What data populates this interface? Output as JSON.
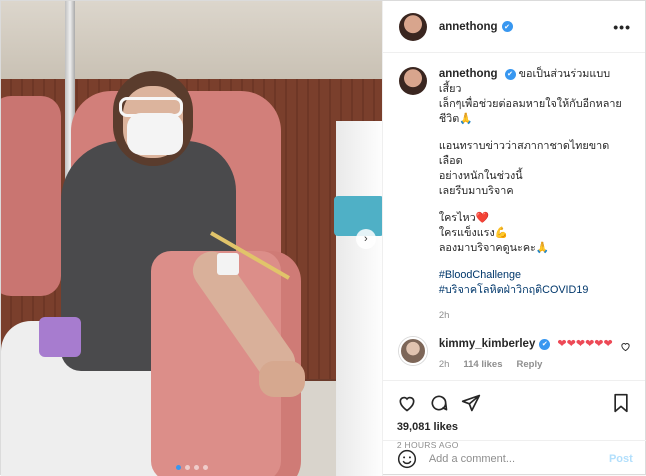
{
  "post": {
    "author": "annethong",
    "verified_mark": "✔",
    "more_icon": "more-dots-icon",
    "media": {
      "dots_count": 4,
      "active_dot": 0,
      "next_icon": "chevron-right-icon",
      "next_glyph": "›"
    },
    "caption": {
      "username": "annethong",
      "lines": [
        "ขอเป็นส่วนร่วมแบบเสี้ยว",
        "เล็กๆเพื่อช่วยต่อลมหายใจให้กับอีกหลาย",
        "ชีวิต🙏"
      ],
      "paragraph2": [
        "แอนทราบข่าวว่าสภากาชาดไทยขาดเลือด",
        "อย่างหนักในช่วงนี้",
        "เลยรีบมาบริจาค"
      ],
      "paragraph3": [
        "ใครไหว❤️",
        "ใครแข็งแรง💪",
        "ลองมาบริจาคดูนะคะ🙏"
      ],
      "hashtags": [
        "#BloodChallenge",
        "#บริจาคโลหิตฝ่าวิกฤติCOVID19"
      ],
      "time": "2h"
    },
    "comments": [
      {
        "username": "kimmy_kimberley",
        "text": "❤❤❤❤❤❤",
        "time": "2h",
        "likes": "114 likes",
        "reply_label": "Reply"
      }
    ],
    "likes": "39,081 likes",
    "timestamp": "2 HOURS AGO",
    "add_comment": {
      "placeholder": "Add a comment...",
      "post_label": "Post",
      "emoji_icon": "smiley-icon"
    }
  },
  "colors": {
    "verified": "#3897f0",
    "link": "#00376b",
    "heart": "#ed4956",
    "post_button": "#b2dffc"
  }
}
